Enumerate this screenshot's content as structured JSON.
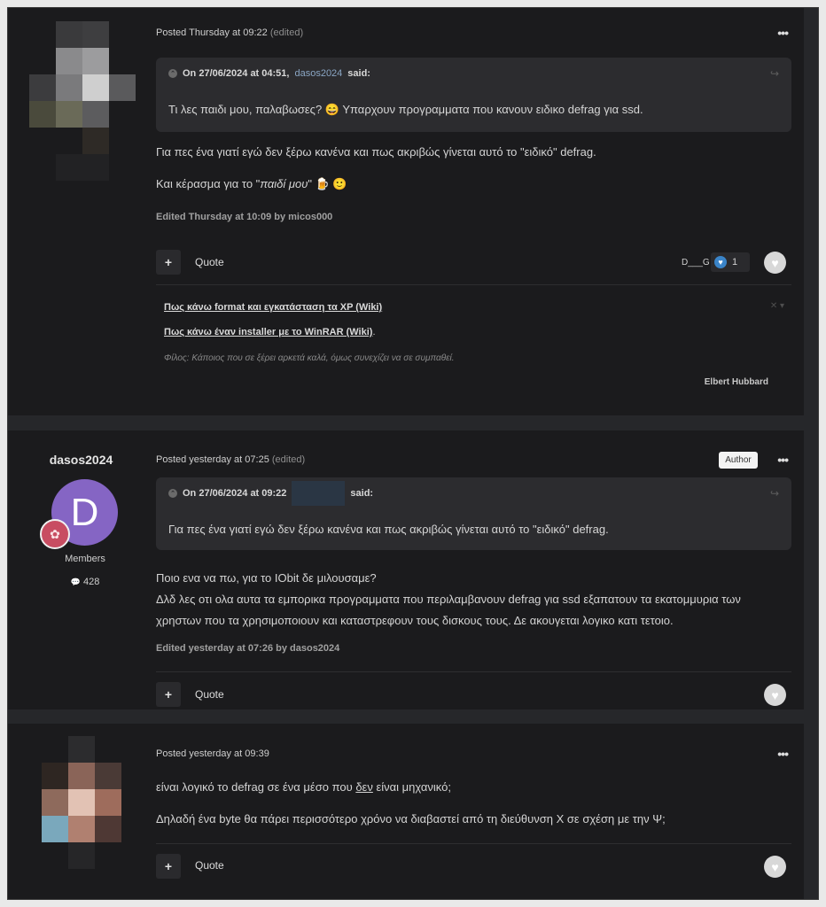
{
  "posts": [
    {
      "posted": "Posted Thursday at 09:22",
      "edited_tag": "(edited)",
      "more": "•••",
      "quote": {
        "head_prefix": "On 27/06/2024 at 04:51,",
        "author": "dasos2024",
        "said": "said:",
        "text": "Τι λες παιδι μου, παλαβωσες? 😄 Υπαρχουν προγραμματα που κανουν ειδικο defrag για ssd."
      },
      "body": [
        "Για πες ένα γιατί εγώ δεν ξέρω κανένα και πως ακριβώς γίνεται αυτό το \"ειδικό\" defrag.",
        "Και κέρασμα για το \"",
        "παιδί μου",
        "\" 🍺 🙂"
      ],
      "edited_by": "Edited Thursday at 10:09 by micos000",
      "quote_label": "Quote",
      "reaction_user": "D___G",
      "reaction_count": "1",
      "signature": {
        "link1": "Πως κάνω format και εγκατάσταση τα XP (Wiki)",
        "link2": "Πως κάνω έναν installer με το WinRAR (Wiki)",
        "link2_suffix": ".",
        "quote": "Φίλος: Κάποιος που σε ξέρει αρκετά καλά, όμως συνεχίζει να σε συμπαθεί.",
        "author": "Elbert Hubbard",
        "close": "✕ ▾"
      }
    },
    {
      "username": "dasos2024",
      "avatar_letter": "D",
      "group": "Members",
      "post_count": "428",
      "posted": "Posted yesterday at 07:25",
      "edited_tag": "(edited)",
      "author_badge": "Author",
      "more": "•••",
      "quote": {
        "head_prefix": "On 27/06/2024 at 09:22",
        "said": "said:",
        "text": "Για πες ένα γιατί εγώ δεν ξέρω κανένα και πως ακριβώς γίνεται αυτό το \"ειδικό\" defrag."
      },
      "body": [
        "Ποιο ενα να πω, για το IObit δε μιλουσαμε?",
        "Δλδ λες οτι ολα αυτα τα εμπορικα προγραμματα που περιλαμβανουν defrag για ssd εξαπατουν τα εκατομμυρια των",
        "χρηστων που τα χρησιμοποιουν και καταστρεφουν τους δισκους τους. Δε ακουγεται λογικο κατι τετοιο."
      ],
      "edited_by": "Edited yesterday at 07:26 by dasos2024",
      "quote_label": "Quote"
    },
    {
      "posted": "Posted yesterday at 09:39",
      "more": "•••",
      "body": [
        "είναι λογικό το defrag σε ένα μέσο που ",
        "δεν",
        " είναι μηχανικό;",
        "Δηλαδή ένα byte θα πάρει περισσότερο χρόνο να διαβαστεί από τη διεύθυνση Χ σε σχέση με την Ψ;"
      ],
      "quote_label": "Quote"
    }
  ],
  "icons": {
    "plus": "+",
    "like": "♥",
    "share": "↪",
    "quote_toggle": "⌃",
    "comment": "💬",
    "rank": "✿"
  },
  "colors": {
    "avatar_bg": "#8565c4",
    "rank_bg": "#c84d62",
    "link": "#8aa6c4",
    "reaction_heart": "#3a84c8"
  }
}
